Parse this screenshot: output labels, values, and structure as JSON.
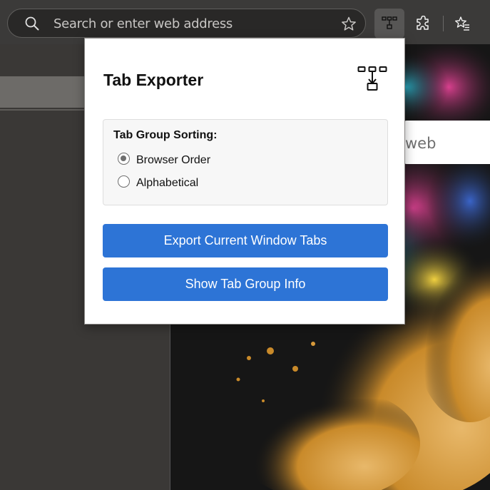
{
  "toolbar": {
    "address_placeholder": "Search or enter web address",
    "icons": [
      "search-icon",
      "favorite-star-icon",
      "tab-exporter-extension-icon",
      "extensions-puzzle-icon",
      "favorites-icon"
    ]
  },
  "background_page": {
    "search_fragment": "web"
  },
  "popup": {
    "title": "Tab Exporter",
    "logo_icon": "tab-hierarchy-icon",
    "sorting": {
      "title": "Tab Group Sorting:",
      "options": [
        {
          "label": "Browser Order",
          "checked": true
        },
        {
          "label": "Alphabetical",
          "checked": false
        }
      ]
    },
    "buttons": {
      "export": "Export Current Window Tabs",
      "info": "Show Tab Group Info"
    }
  },
  "colors": {
    "accent": "#2d74d6",
    "toolbar_bg": "#3b3a39",
    "popup_bg": "#ffffff"
  }
}
